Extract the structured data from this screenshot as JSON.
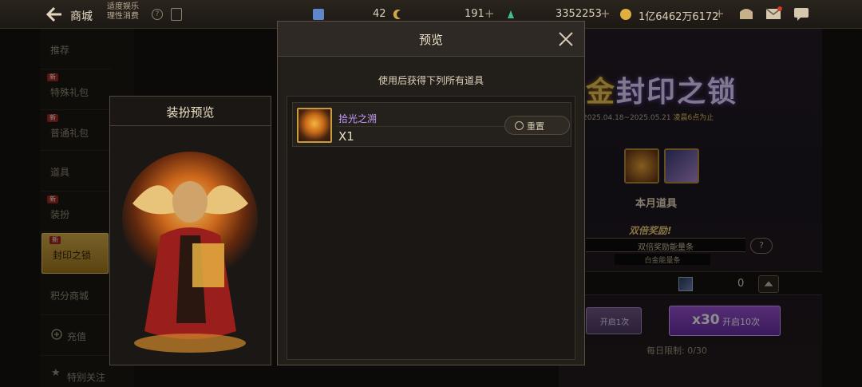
{
  "header": {
    "title": "商城",
    "subtitle_line1": "适度娱乐",
    "subtitle_line2": "理性消费",
    "help_glyph": "?",
    "currencies": [
      {
        "icon": "ticket-icon",
        "value": "42",
        "color": "#5f86c9"
      },
      {
        "icon": "moon-coin-icon",
        "value": "191",
        "color": "#cfa64a"
      },
      {
        "icon": "gem-icon",
        "value": "3352253",
        "color": "#3dbf8e"
      },
      {
        "icon": "gold-coin-icon",
        "value": "1亿6462万6172",
        "color": "#e0b03f"
      }
    ],
    "plus": "+"
  },
  "sidebar": {
    "badge_text": "新",
    "items": [
      {
        "label": "推荐",
        "badge": false,
        "active": false
      },
      {
        "label": "特殊礼包",
        "badge": true,
        "active": false
      },
      {
        "label": "普通礼包",
        "badge": true,
        "active": false
      },
      {
        "label": "道具",
        "badge": false,
        "active": false
      },
      {
        "label": "装扮",
        "badge": true,
        "active": false
      },
      {
        "label": "封印之锁",
        "badge": true,
        "active": true
      },
      {
        "label": "积分商城",
        "badge": false,
        "active": false
      },
      {
        "label": "充值",
        "badge": false,
        "active": false
      },
      {
        "label": "特别关注",
        "badge": false,
        "active": false
      }
    ]
  },
  "banner": {
    "title_gold": "金",
    "title_rest": "封印之锁",
    "date_range": "2025.04.18~2025.05.21",
    "date_note": "凌晨6点为止",
    "monthly_label": "本月道具",
    "double_badge": "双倍奖励!",
    "ribbon_text": "双倍奖励能量条",
    "ribbon_sub": "白金能量条",
    "row_count": "0",
    "open_small": "开启1次",
    "open_big_x": "x30",
    "open_big_label": "开启10次",
    "daily_limit": "每日限制: 0/30"
  },
  "costume_panel": {
    "title": "装扮预览"
  },
  "dialog": {
    "title": "预览",
    "description": "使用后获得下列所有道具",
    "items": [
      {
        "name": "拾光之溯",
        "quantity": "X1",
        "reset_label": "重置"
      }
    ]
  },
  "colors": {
    "accent_gold": "#d9b04a",
    "item_name_purple": "#c79cff",
    "badge_red": "#a4271f"
  }
}
